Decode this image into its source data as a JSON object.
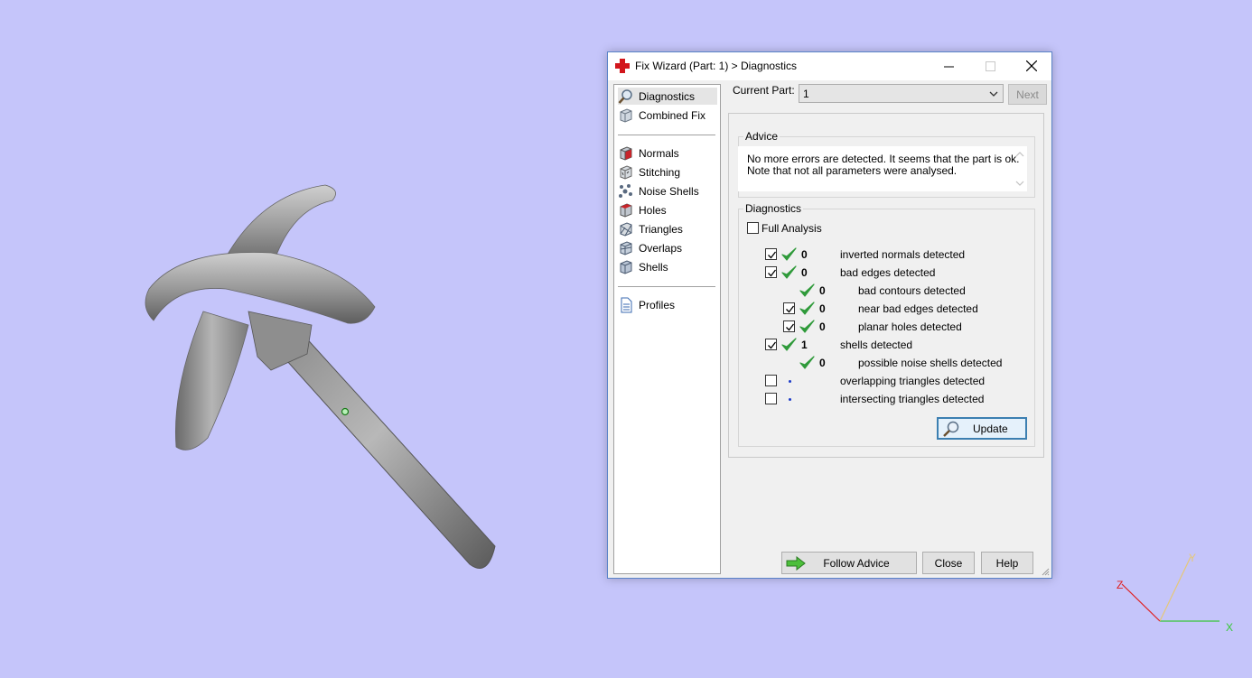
{
  "window": {
    "title": "Fix Wizard (Part: 1) > Diagnostics",
    "minimize_glyph": "—",
    "maximize_glyph": "☐",
    "close_glyph": "✕"
  },
  "nav": {
    "items": [
      {
        "label": "Diagnostics",
        "icon": "magnifier-icon",
        "selected": true
      },
      {
        "label": "Combined Fix",
        "icon": "cube-icon"
      },
      {
        "label": "Normals",
        "icon": "normals-cube-icon"
      },
      {
        "label": "Stitching",
        "icon": "stitching-cube-icon"
      },
      {
        "label": "Noise Shells",
        "icon": "noise-shells-icon"
      },
      {
        "label": "Holes",
        "icon": "holes-cube-icon"
      },
      {
        "label": "Triangles",
        "icon": "triangles-cube-icon"
      },
      {
        "label": "Overlaps",
        "icon": "overlaps-cube-icon"
      },
      {
        "label": "Shells",
        "icon": "shells-cube-icon"
      },
      {
        "label": "Profiles",
        "icon": "document-icon"
      }
    ]
  },
  "part": {
    "label": "Current Part:",
    "value": "1",
    "next_label": "Next"
  },
  "advice": {
    "title": "Advice",
    "line1": "No more errors are detected. It seems that the part is ok.",
    "line2": "Note that not all parameters were analysed."
  },
  "diagnostics": {
    "title": "Diagnostics",
    "full_analysis_label": "Full Analysis",
    "full_analysis_checked": false,
    "rows": [
      {
        "checkbox": true,
        "checked": true,
        "status": "ok",
        "count": "0",
        "label": "inverted normals detected",
        "indent": 0
      },
      {
        "checkbox": true,
        "checked": true,
        "status": "ok",
        "count": "0",
        "label": "bad edges detected",
        "indent": 0
      },
      {
        "checkbox": false,
        "checked": false,
        "status": "ok",
        "count": "0",
        "label": "bad contours detected",
        "indent": 1
      },
      {
        "checkbox": true,
        "checked": true,
        "status": "ok",
        "count": "0",
        "label": "near bad edges detected",
        "indent": 1
      },
      {
        "checkbox": true,
        "checked": true,
        "status": "ok",
        "count": "0",
        "label": "planar holes detected",
        "indent": 1
      },
      {
        "checkbox": true,
        "checked": true,
        "status": "ok",
        "count": "1",
        "label": "shells detected",
        "indent": 0
      },
      {
        "checkbox": false,
        "checked": false,
        "status": "ok",
        "count": "0",
        "label": "possible noise shells detected",
        "indent": 1
      },
      {
        "checkbox": true,
        "checked": false,
        "status": "not-analysed",
        "count": "",
        "label": "overlapping triangles detected",
        "indent": 0
      },
      {
        "checkbox": true,
        "checked": false,
        "status": "not-analysed",
        "count": "",
        "label": "intersecting triangles detected",
        "indent": 0
      }
    ],
    "update_label": "Update"
  },
  "footer": {
    "follow_advice_label": "Follow Advice",
    "close_label": "Close",
    "help_label": "Help"
  },
  "axes": {
    "x_label": "X",
    "y_label": "Y",
    "z_label": "Z",
    "x_color": "#36c836",
    "y_color": "#e6c878",
    "z_color": "#e01e1e"
  },
  "colors": {
    "viewport_bg": "#c5c5fa",
    "check_green": "#2f9a3a"
  }
}
